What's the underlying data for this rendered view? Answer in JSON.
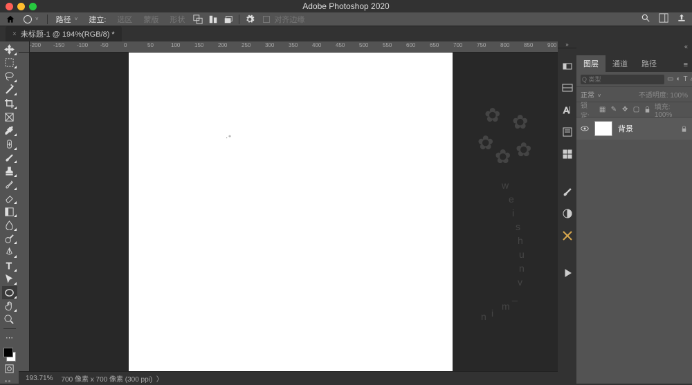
{
  "app_title": "Adobe Photoshop 2020",
  "toolbar": {
    "mode_label": "路径",
    "make_label": "建立:",
    "selection": "选区",
    "mask": "蒙版",
    "shape": "形状",
    "align": "对齐边缘"
  },
  "tab": {
    "title": "未标题-1 @ 194%(RGB/8) *"
  },
  "ruler_marks": [
    "-200",
    "-150",
    "-100",
    "-50",
    "0",
    "50",
    "100",
    "150",
    "200",
    "250",
    "300",
    "350",
    "400",
    "450",
    "500",
    "550",
    "600",
    "650",
    "700",
    "750",
    "800",
    "850",
    "900"
  ],
  "panels": {
    "tabs": [
      "图层",
      "通道",
      "路径"
    ],
    "search_placeholder": "Q 类型",
    "blend": "正常",
    "opacity_label": "不透明度:",
    "opacity_val": "100%",
    "lock_label": "锁定:",
    "fill_label": "填充:",
    "fill_val": "100%",
    "layer_name": "背景"
  },
  "status": {
    "zoom": "193.71%",
    "doc": "700 像素 x 700 像素 (300 ppi)"
  }
}
